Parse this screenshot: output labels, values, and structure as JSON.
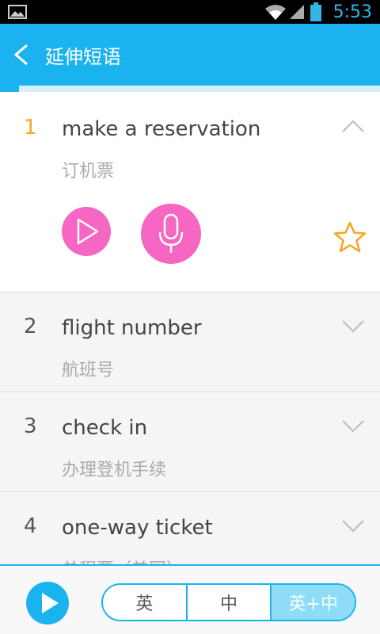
{
  "status": {
    "time": "5:53"
  },
  "header": {
    "title": "延伸短语",
    "progress_fraction": 0.05
  },
  "phrases": [
    {
      "num": "1",
      "en": "make a reservation",
      "zh": "订机票",
      "expanded": true
    },
    {
      "num": "2",
      "en": "flight number",
      "zh": "航班号",
      "expanded": false
    },
    {
      "num": "3",
      "en": "check in",
      "zh": "办理登机手续",
      "expanded": false
    },
    {
      "num": "4",
      "en": "one-way ticket",
      "zh": "单程票（美国）",
      "expanded": false
    }
  ],
  "bottom": {
    "modes": [
      "英",
      "中",
      "英+中"
    ],
    "active_mode": 2
  },
  "colors": {
    "accent": "#1ab3f0",
    "pink": "#f567c2",
    "star": "#f5a623"
  }
}
